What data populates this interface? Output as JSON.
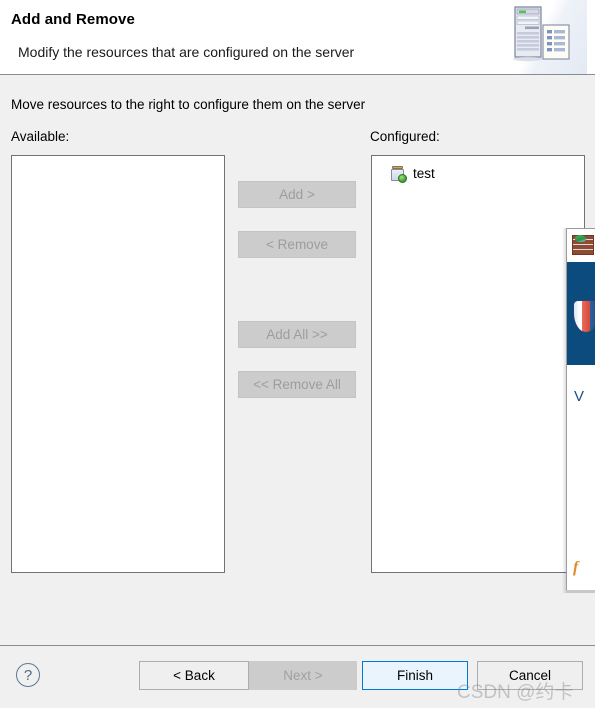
{
  "dialog": {
    "title": "Add and Remove",
    "subtitle": "Modify the resources that are configured on the server",
    "header_icon": "server-document-icon"
  },
  "main": {
    "instruction": "Move resources to the right to configure them on the server",
    "available": {
      "label": "Available:",
      "items": []
    },
    "configured": {
      "label": "Configured:",
      "items": [
        {
          "label": "test",
          "icon": "web-module-icon"
        }
      ]
    },
    "transfer_buttons": [
      {
        "label": "Add >",
        "enabled": false
      },
      {
        "label": "< Remove",
        "enabled": false
      },
      {
        "label": "Add All >>",
        "enabled": false
      },
      {
        "label": "<< Remove All",
        "enabled": false
      }
    ]
  },
  "footer": {
    "help_label": "?",
    "back_label": "< Back",
    "next_label": "Next >",
    "finish_label": "Finish",
    "cancel_label": "Cancel"
  },
  "overlay": {
    "title_icon": "firewall-brick-icon",
    "banner_icon": "shield-icon",
    "fragment_text_1": "V",
    "fragment_text_2": "f"
  },
  "watermark": {
    "text": "CSDN @约卡"
  },
  "colors": {
    "dialog_background": "#f0f0f0",
    "header_background": "#ffffff",
    "list_background": "#ffffff",
    "list_border": "#6f7278",
    "separator": "#898c95",
    "default_button_border": "#0078d7",
    "default_button_fill": "#eaf4fd",
    "disabled_text": "#9d9d9d",
    "disabled_fill": "#cccccc",
    "overlay_banner": "#0c4b7e"
  }
}
